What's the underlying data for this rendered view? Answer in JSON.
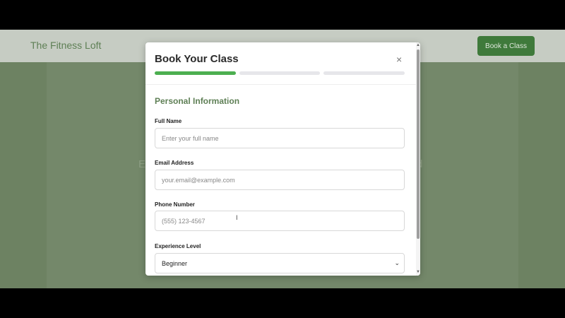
{
  "site": {
    "brand": "The Fitness Loft",
    "cta_label": "Book a Class",
    "hero_left_fragment": "E",
    "hero_right_fragment": "d"
  },
  "modal": {
    "title": "Book Your Class",
    "close_glyph": "×",
    "progress": {
      "total_steps": 3,
      "current_step": 1
    },
    "section_title": "Personal Information",
    "fields": [
      {
        "label": "Full Name",
        "placeholder": "Enter your full name",
        "value": ""
      },
      {
        "label": "Email Address",
        "placeholder": "your.email@example.com",
        "value": ""
      },
      {
        "label": "Phone Number",
        "placeholder": "(555) 123-4567",
        "value": ""
      }
    ],
    "experience": {
      "label": "Experience Level",
      "selected": "Beginner"
    }
  },
  "icons": {
    "close": "close-icon",
    "chevron": "chevron-down-icon",
    "cursor": "text-cursor-icon",
    "scroll_up": "scroll-up-icon",
    "scroll_down": "scroll-down-icon"
  },
  "colors": {
    "accent": "#4caf50",
    "brand_green": "#5e7f55",
    "cta_bg": "#3f7a3b",
    "overlay": "#6d8262"
  }
}
